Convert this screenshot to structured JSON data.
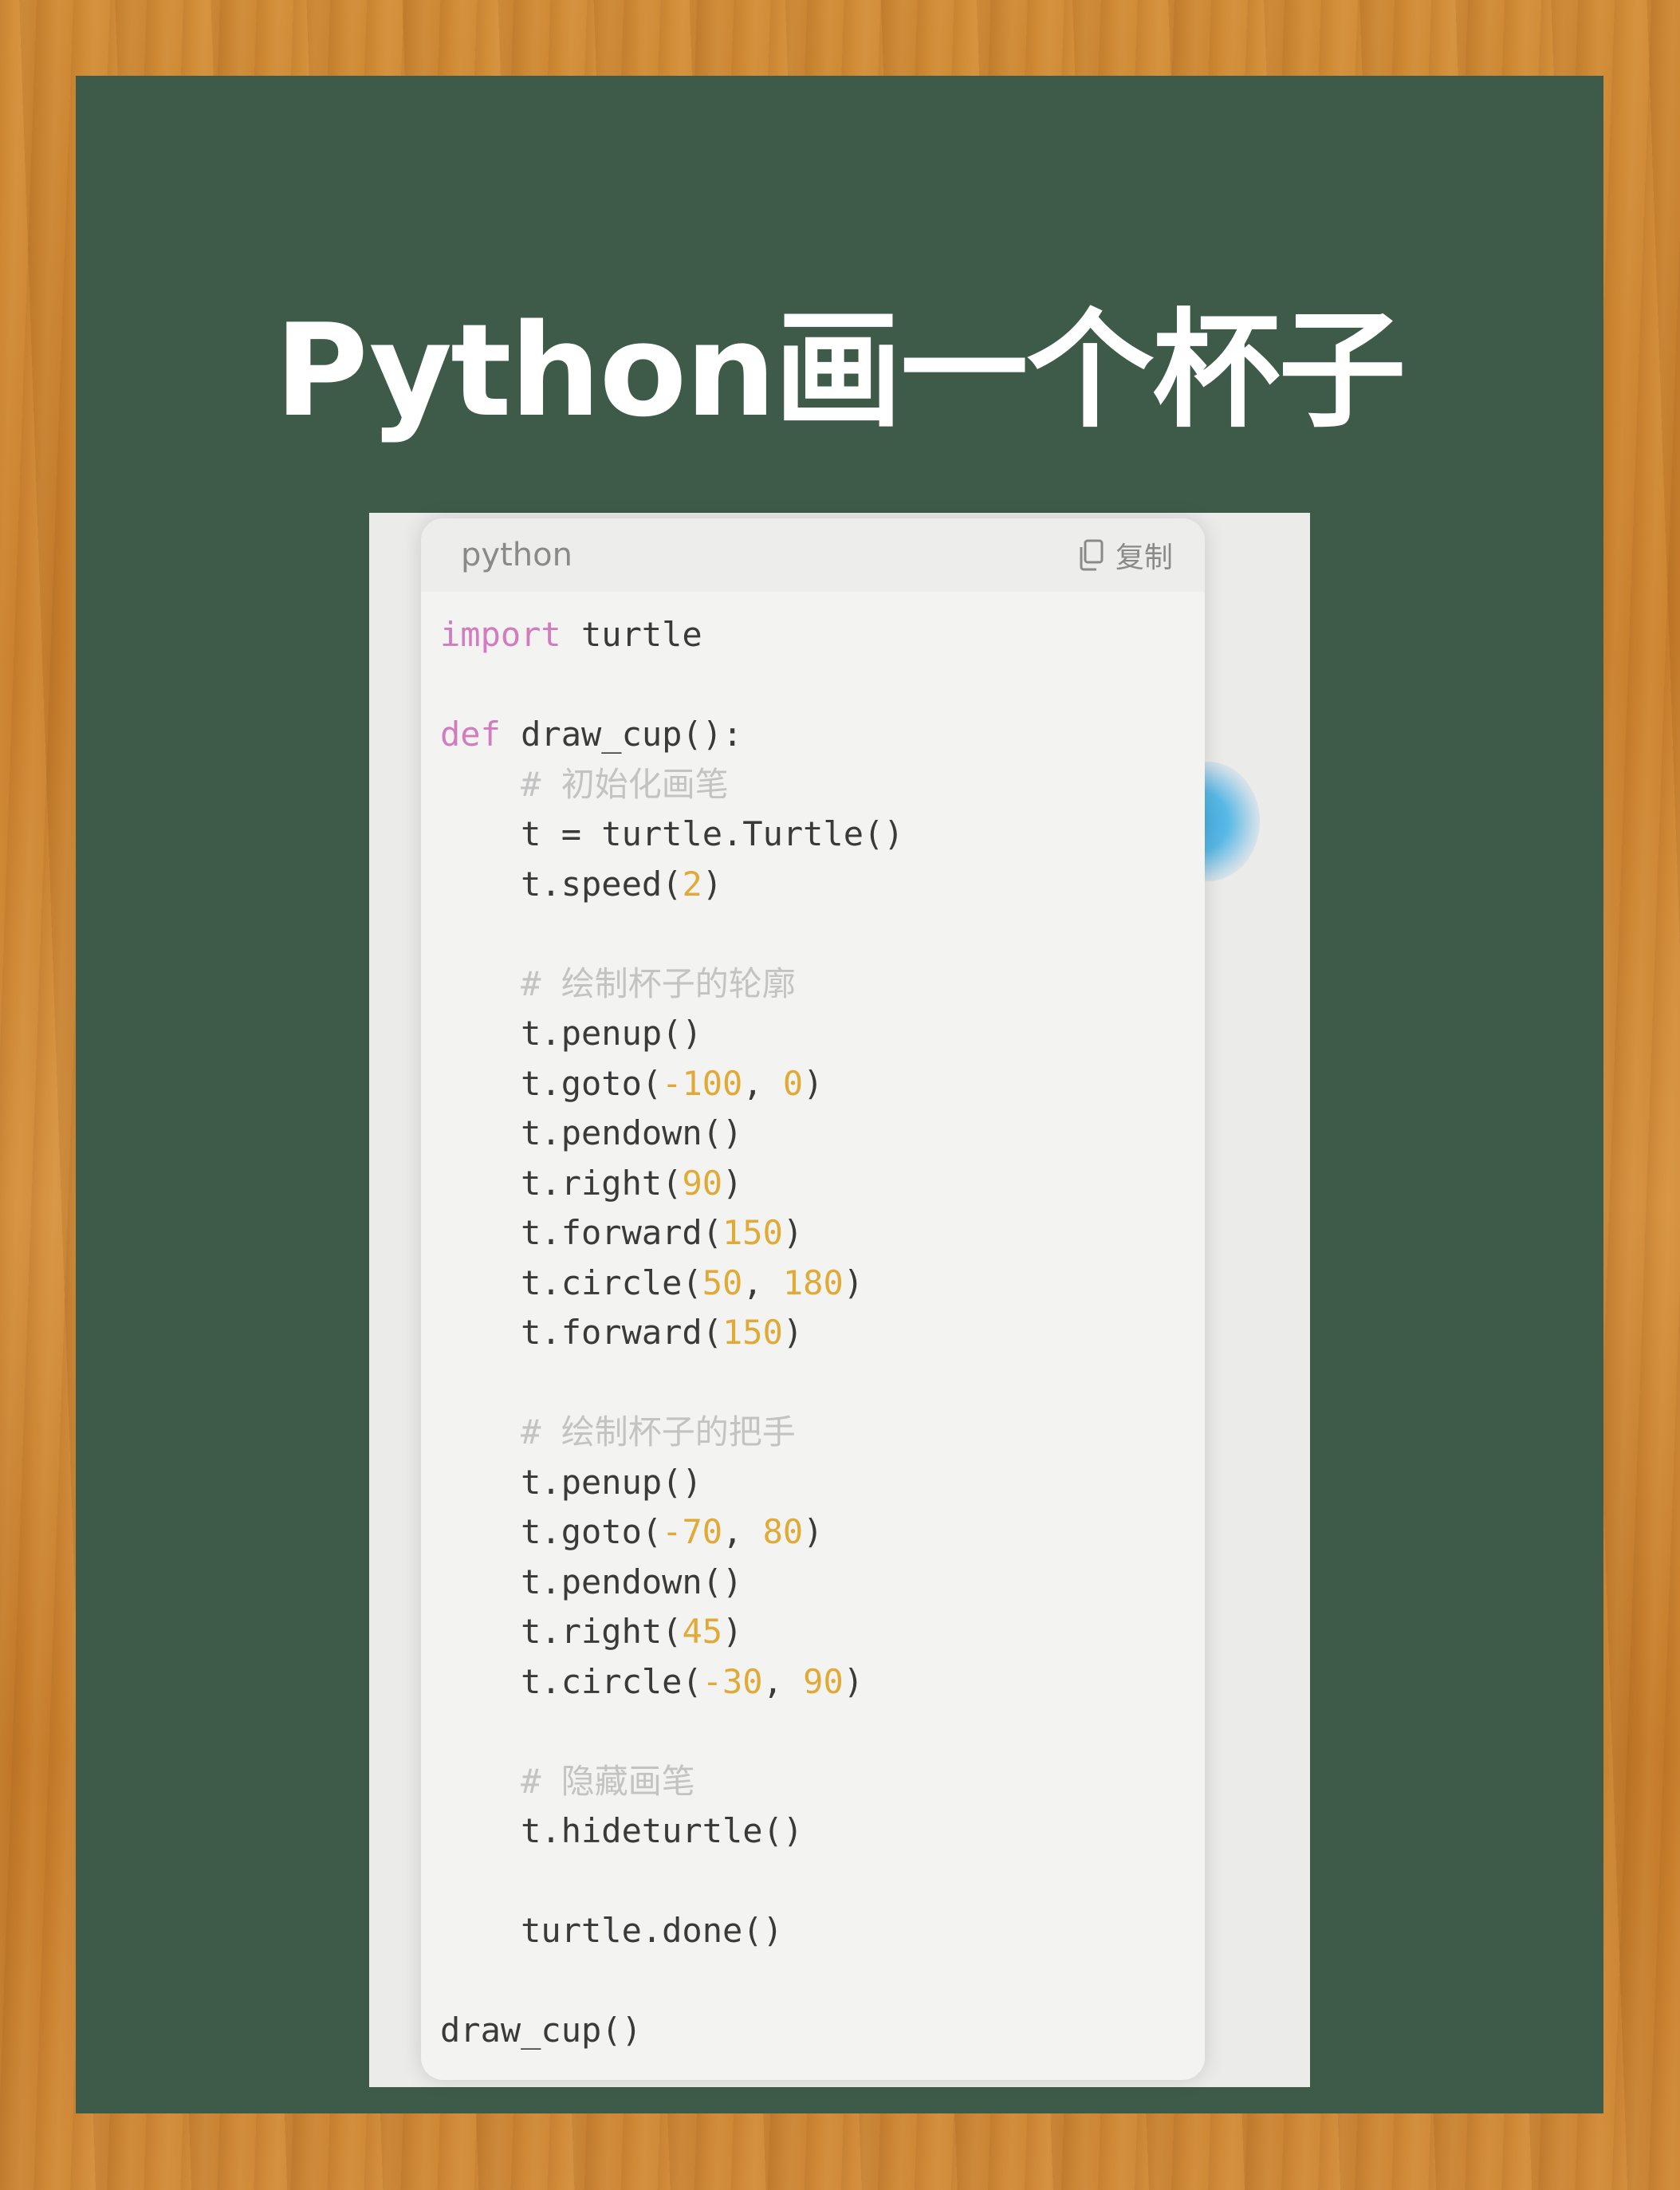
{
  "page": {
    "title": "Python画一个杯子"
  },
  "code_block": {
    "language": "python",
    "copy_label": "复制",
    "copy_icon": "copy-icon",
    "lines": [
      [
        {
          "t": "import",
          "c": "kw"
        },
        {
          "t": " turtle",
          "c": "tx"
        }
      ],
      [],
      [
        {
          "t": "def",
          "c": "kw"
        },
        {
          "t": " draw_cup():",
          "c": "tx"
        }
      ],
      [
        {
          "t": "    ",
          "c": "tx"
        },
        {
          "t": "# 初始化画笔",
          "c": "cm"
        }
      ],
      [
        {
          "t": "    t = turtle.Turtle()",
          "c": "tx"
        }
      ],
      [
        {
          "t": "    t.speed(",
          "c": "tx"
        },
        {
          "t": "2",
          "c": "num"
        },
        {
          "t": ")",
          "c": "tx"
        }
      ],
      [],
      [
        {
          "t": "    ",
          "c": "tx"
        },
        {
          "t": "# 绘制杯子的轮廓",
          "c": "cm"
        }
      ],
      [
        {
          "t": "    t.penup()",
          "c": "tx"
        }
      ],
      [
        {
          "t": "    t.goto(",
          "c": "tx"
        },
        {
          "t": "-100",
          "c": "num"
        },
        {
          "t": ", ",
          "c": "tx"
        },
        {
          "t": "0",
          "c": "num"
        },
        {
          "t": ")",
          "c": "tx"
        }
      ],
      [
        {
          "t": "    t.pendown()",
          "c": "tx"
        }
      ],
      [
        {
          "t": "    t.right(",
          "c": "tx"
        },
        {
          "t": "90",
          "c": "num"
        },
        {
          "t": ")",
          "c": "tx"
        }
      ],
      [
        {
          "t": "    t.forward(",
          "c": "tx"
        },
        {
          "t": "150",
          "c": "num"
        },
        {
          "t": ")",
          "c": "tx"
        }
      ],
      [
        {
          "t": "    t.circle(",
          "c": "tx"
        },
        {
          "t": "50",
          "c": "num"
        },
        {
          "t": ", ",
          "c": "tx"
        },
        {
          "t": "180",
          "c": "num"
        },
        {
          "t": ")",
          "c": "tx"
        }
      ],
      [
        {
          "t": "    t.forward(",
          "c": "tx"
        },
        {
          "t": "150",
          "c": "num"
        },
        {
          "t": ")",
          "c": "tx"
        }
      ],
      [],
      [
        {
          "t": "    ",
          "c": "tx"
        },
        {
          "t": "# 绘制杯子的把手",
          "c": "cm"
        }
      ],
      [
        {
          "t": "    t.penup()",
          "c": "tx"
        }
      ],
      [
        {
          "t": "    t.goto(",
          "c": "tx"
        },
        {
          "t": "-70",
          "c": "num"
        },
        {
          "t": ", ",
          "c": "tx"
        },
        {
          "t": "80",
          "c": "num"
        },
        {
          "t": ")",
          "c": "tx"
        }
      ],
      [
        {
          "t": "    t.pendown()",
          "c": "tx"
        }
      ],
      [
        {
          "t": "    t.right(",
          "c": "tx"
        },
        {
          "t": "45",
          "c": "num"
        },
        {
          "t": ")",
          "c": "tx"
        }
      ],
      [
        {
          "t": "    t.circle(",
          "c": "tx"
        },
        {
          "t": "-30",
          "c": "num"
        },
        {
          "t": ", ",
          "c": "tx"
        },
        {
          "t": "90",
          "c": "num"
        },
        {
          "t": ")",
          "c": "tx"
        }
      ],
      [],
      [
        {
          "t": "    ",
          "c": "tx"
        },
        {
          "t": "# 隐藏画笔",
          "c": "cm"
        }
      ],
      [
        {
          "t": "    t.hideturtle()",
          "c": "tx"
        }
      ],
      [],
      [
        {
          "t": "    turtle.done()",
          "c": "tx"
        }
      ],
      [],
      [
        {
          "t": "draw_cup()",
          "c": "tx"
        }
      ]
    ]
  },
  "colors": {
    "board": "#3e5b4a",
    "keyword": "#d27cbf",
    "number": "#e1a935",
    "comment": "#c3c3c3",
    "text": "#3a3a3a"
  }
}
